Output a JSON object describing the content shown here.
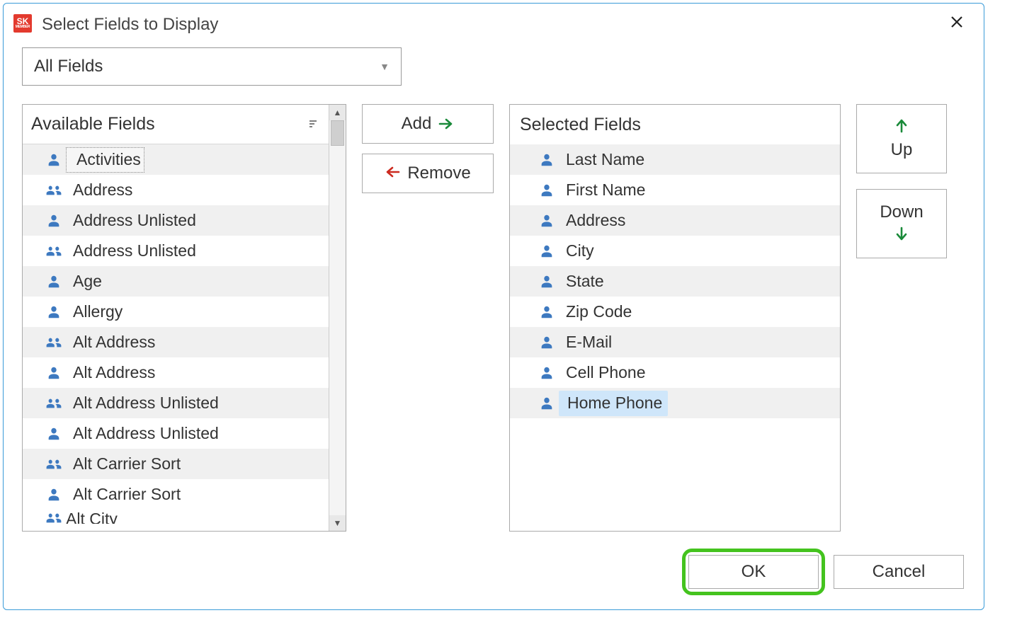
{
  "dialog": {
    "title": "Select Fields to Display",
    "filter_label": "All Fields",
    "ok_label": "OK",
    "cancel_label": "Cancel"
  },
  "buttons": {
    "add": "Add",
    "remove": "Remove",
    "up": "Up",
    "down": "Down"
  },
  "available": {
    "header": "Available Fields",
    "items": [
      {
        "label": "Activities",
        "icon": "person",
        "active": true
      },
      {
        "label": "Address",
        "icon": "group"
      },
      {
        "label": "Address Unlisted",
        "icon": "person"
      },
      {
        "label": "Address Unlisted",
        "icon": "group"
      },
      {
        "label": "Age",
        "icon": "person"
      },
      {
        "label": "Allergy",
        "icon": "person"
      },
      {
        "label": "Alt Address",
        "icon": "group"
      },
      {
        "label": "Alt Address",
        "icon": "person"
      },
      {
        "label": "Alt Address Unlisted",
        "icon": "group"
      },
      {
        "label": "Alt Address Unlisted",
        "icon": "person"
      },
      {
        "label": "Alt Carrier Sort",
        "icon": "group"
      },
      {
        "label": "Alt Carrier Sort",
        "icon": "person"
      }
    ],
    "partial_next": {
      "label": "Alt City",
      "icon": "group"
    }
  },
  "selected": {
    "header": "Selected Fields",
    "items": [
      {
        "label": "Last Name",
        "icon": "person"
      },
      {
        "label": "First Name",
        "icon": "person"
      },
      {
        "label": "Address",
        "icon": "person"
      },
      {
        "label": "City",
        "icon": "person"
      },
      {
        "label": "State",
        "icon": "person"
      },
      {
        "label": "Zip Code",
        "icon": "person"
      },
      {
        "label": "E-Mail",
        "icon": "person"
      },
      {
        "label": "Cell Phone",
        "icon": "person"
      },
      {
        "label": "Home Phone",
        "icon": "person",
        "highlighted": true
      }
    ]
  }
}
